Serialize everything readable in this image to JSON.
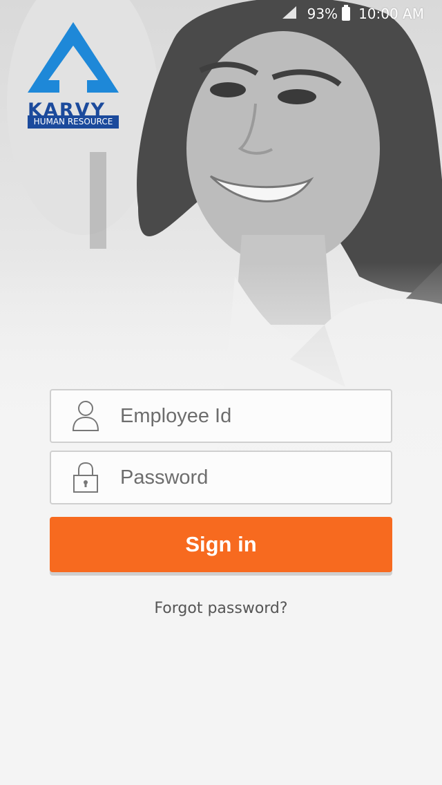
{
  "status_bar": {
    "signal_icon": "signal-icon",
    "battery_percent": "93%",
    "battery_icon": "battery-icon",
    "time": "10:00 AM"
  },
  "logo": {
    "brand": "KARVY",
    "subtitle": "HUMAN RESOURCE",
    "accent_color": "#1e88d8",
    "brand_color": "#1b4a9c"
  },
  "login": {
    "employee_id": {
      "placeholder": "Employee Id",
      "value": "",
      "icon": "user-icon"
    },
    "password": {
      "placeholder": "Password",
      "value": "",
      "icon": "lock-icon"
    },
    "signin_label": "Sign in",
    "signin_color": "#f76a1f",
    "forgot_label": "Forgot password?"
  }
}
